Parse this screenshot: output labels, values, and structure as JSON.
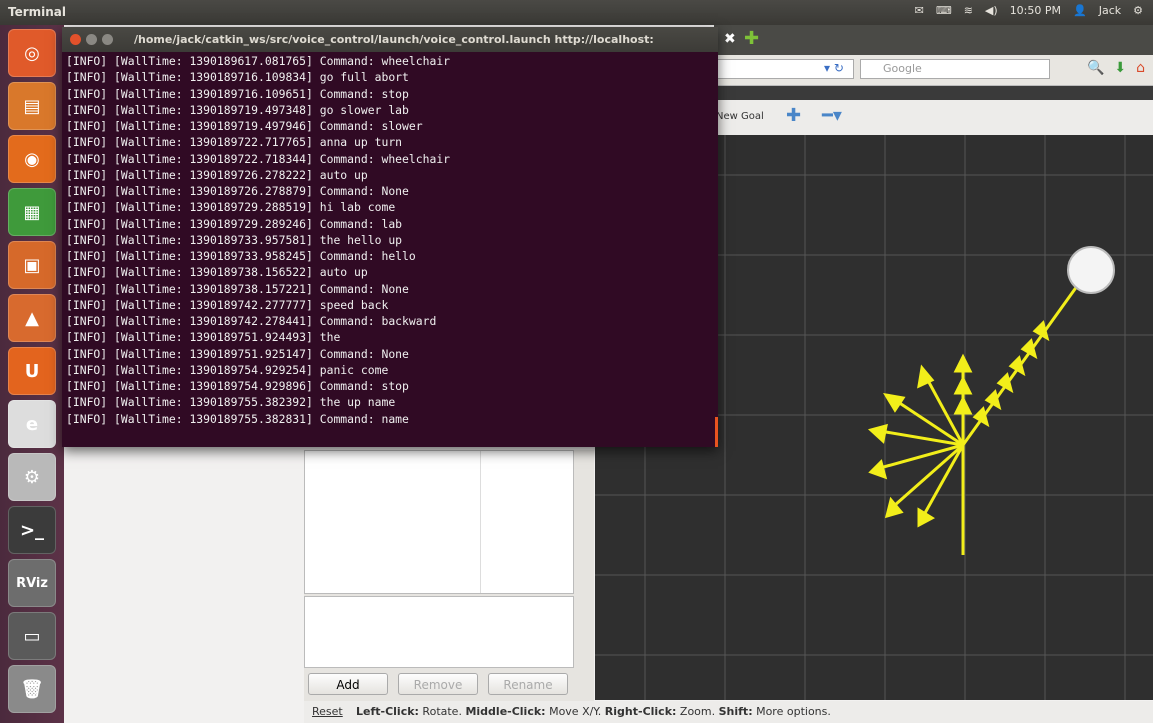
{
  "topbar": {
    "app_name": "Terminal",
    "clock": "10:50 PM",
    "user": "Jack"
  },
  "launcher": {
    "items": [
      {
        "name": "dash-home-icon",
        "color": "#e05a2a",
        "glyph": "◎"
      },
      {
        "name": "files-icon",
        "color": "#d9782b",
        "glyph": "▤"
      },
      {
        "name": "firefox-icon",
        "color": "#e36b1c",
        "glyph": "◉"
      },
      {
        "name": "libreoffice-calc-icon",
        "color": "#3f9a3b",
        "glyph": "▦"
      },
      {
        "name": "libreoffice-impress-icon",
        "color": "#d6692a",
        "glyph": "▣"
      },
      {
        "name": "software-center-icon",
        "color": "#d86a2e",
        "glyph": "▲"
      },
      {
        "name": "ubuntu-one-icon",
        "color": "#e3641e",
        "glyph": "U"
      },
      {
        "name": "amazon-icon",
        "color": "#dddddd",
        "glyph": "e"
      },
      {
        "name": "system-settings-icon",
        "color": "#b9b9b9",
        "glyph": "⚙"
      },
      {
        "name": "terminal-icon",
        "color": "#3b3b3b",
        "glyph": ">_"
      },
      {
        "name": "rviz-icon",
        "color": "#6d6d6d",
        "glyph": "RViz"
      },
      {
        "name": "workspace-switcher-icon",
        "color": "#5a5a5a",
        "glyph": "▭"
      },
      {
        "name": "trash-icon",
        "color": "#8a8a8a",
        "glyph": "🗑"
      }
    ]
  },
  "browser": {
    "search_placeholder": "Google",
    "new_goal_label": "New Goal"
  },
  "rviz_panel": {
    "buttons": {
      "add": "Add",
      "remove": "Remove",
      "rename": "Rename"
    },
    "status": {
      "reset": "Reset",
      "help": [
        {
          "b": "Left-Click:",
          "t": " Rotate. "
        },
        {
          "b": "Middle-Click:",
          "t": " Move X/Y. "
        },
        {
          "b": "Right-Click:",
          "t": " Zoom. "
        },
        {
          "b": "Shift:",
          "t": " More options."
        }
      ]
    }
  },
  "terminal": {
    "title": "/home/jack/catkin_ws/src/voice_control/launch/voice_control.launch http://localhost:",
    "lines": [
      "[INFO] [WallTime: 1390189617.081765] Command: wheelchair",
      "[INFO] [WallTime: 1390189716.109834] go full abort",
      "[INFO] [WallTime: 1390189716.109651] Command: stop",
      "[INFO] [WallTime: 1390189719.497348] go slower lab",
      "[INFO] [WallTime: 1390189719.497946] Command: slower",
      "[INFO] [WallTime: 1390189722.717765] anna up turn",
      "[INFO] [WallTime: 1390189722.718344] Command: wheelchair",
      "[INFO] [WallTime: 1390189726.278222] auto up",
      "[INFO] [WallTime: 1390189726.278879] Command: None",
      "[INFO] [WallTime: 1390189729.288519] hi lab come",
      "[INFO] [WallTime: 1390189729.289246] Command: lab",
      "[INFO] [WallTime: 1390189733.957581] the hello up",
      "[INFO] [WallTime: 1390189733.958245] Command: hello",
      "[INFO] [WallTime: 1390189738.156522] auto up",
      "[INFO] [WallTime: 1390189738.157221] Command: None",
      "[INFO] [WallTime: 1390189742.277777] speed back",
      "[INFO] [WallTime: 1390189742.278441] Command: backward",
      "[INFO] [WallTime: 1390189751.924493] the",
      "[INFO] [WallTime: 1390189751.925147] Command: None",
      "[INFO] [WallTime: 1390189754.929254] panic come",
      "[INFO] [WallTime: 1390189754.929896] Command: stop",
      "[INFO] [WallTime: 1390189755.382392] the up name",
      "[INFO] [WallTime: 1390189755.382831] Command: name"
    ]
  }
}
